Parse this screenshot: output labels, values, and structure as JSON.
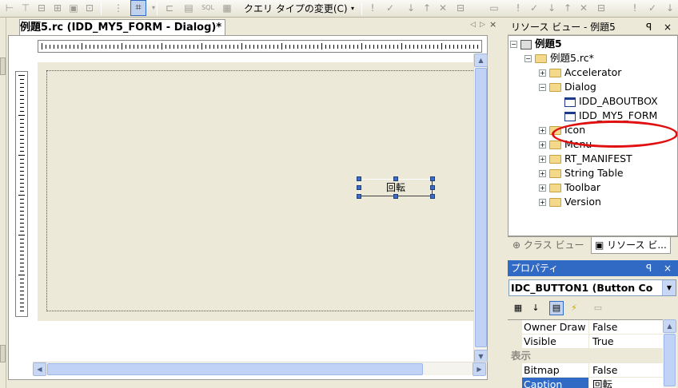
{
  "toolbar": {
    "query_type_label": "クエリ タイプの変更(C)",
    "dropdown_arrow": "▾"
  },
  "document": {
    "tab_title": "例題5.rc (IDD_MY5_FORM - Dialog)*",
    "nav_left": "◁",
    "nav_right": "▷",
    "close": "×",
    "button_caption": "回転"
  },
  "resource_view": {
    "title": "リソース ビュー - 例題5",
    "pin": "ꟼ",
    "close": "×",
    "tree": [
      {
        "label": "例題5",
        "icon": "project-icon",
        "exp": "−"
      },
      {
        "label": "例題5.rc*",
        "icon": "folder-icon",
        "exp": "−"
      },
      {
        "label": "Accelerator",
        "icon": "folder-icon",
        "exp": "+"
      },
      {
        "label": "Dialog",
        "icon": "folder-icon",
        "exp": "−"
      },
      {
        "label": "IDD_ABOUTBOX",
        "icon": "dialog-icon",
        "exp": ""
      },
      {
        "label": "IDD_MY5_FORM",
        "icon": "dialog-icon",
        "exp": ""
      },
      {
        "label": "Icon",
        "icon": "folder-icon",
        "exp": "+"
      },
      {
        "label": "Menu",
        "icon": "folder-icon",
        "exp": "+"
      },
      {
        "label": "RT_MANIFEST",
        "icon": "folder-icon",
        "exp": "+"
      },
      {
        "label": "String Table",
        "icon": "folder-icon",
        "exp": "+"
      },
      {
        "label": "Toolbar",
        "icon": "folder-icon",
        "exp": "+"
      },
      {
        "label": "Version",
        "icon": "folder-icon",
        "exp": "+"
      }
    ],
    "tab_class": "クラス ビュー",
    "tab_resource": "リソース ビ..."
  },
  "properties": {
    "title": "プロパティ",
    "pin": "ꟼ",
    "close": "×",
    "object": "IDC_BUTTON1 (Button Co",
    "rows": [
      {
        "name": "Owner Draw",
        "value": "False",
        "kind": "prop"
      },
      {
        "name": "Visible",
        "value": "True",
        "kind": "prop"
      },
      {
        "name": "表示",
        "value": "",
        "kind": "category"
      },
      {
        "name": "Bitmap",
        "value": "False",
        "kind": "prop"
      },
      {
        "name": "Caption",
        "value": "回転",
        "kind": "selected"
      }
    ]
  },
  "colors": {
    "panel_bg": "#ece9d8",
    "selection_blue": "#316ac5",
    "highlight_red": "#e01010"
  }
}
